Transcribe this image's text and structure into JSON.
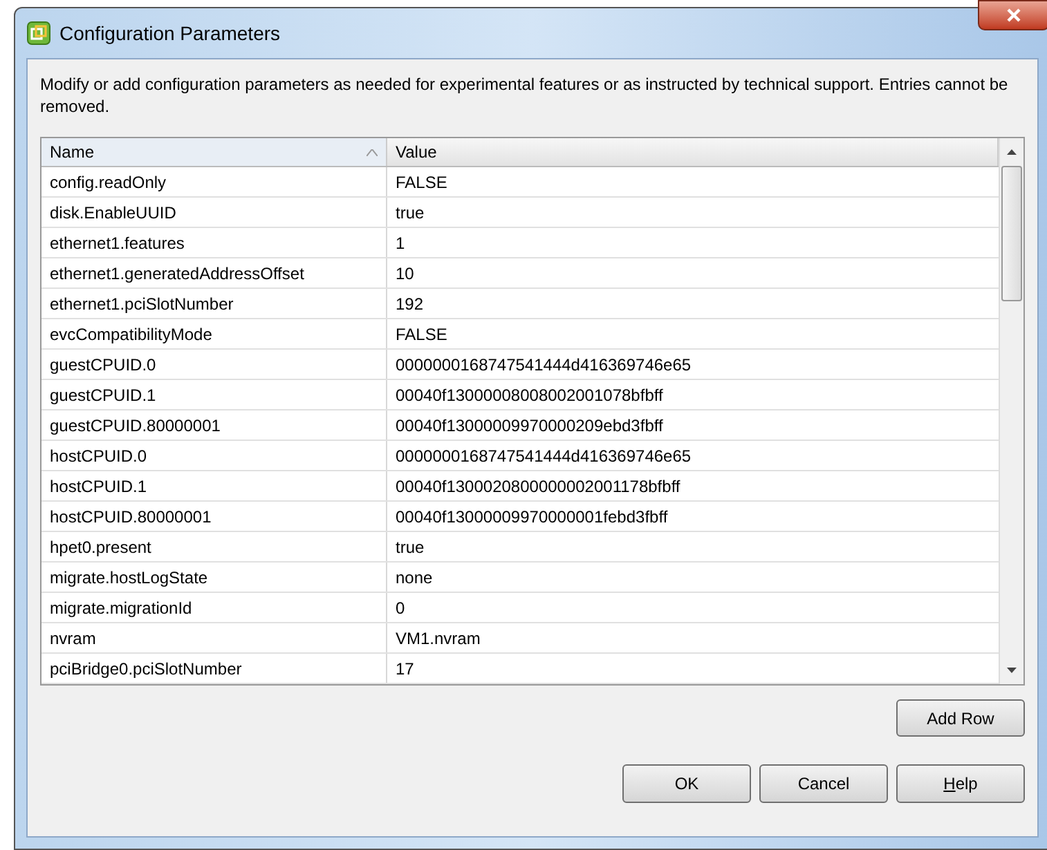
{
  "window": {
    "title": "Configuration Parameters"
  },
  "description": "Modify or add configuration parameters as needed for experimental features or as instructed by technical support. Entries cannot be removed.",
  "table": {
    "columns": [
      {
        "label": "Name",
        "sorted": true
      },
      {
        "label": "Value",
        "sorted": false
      }
    ],
    "rows": [
      [
        "config.readOnly",
        "FALSE"
      ],
      [
        "disk.EnableUUID",
        "true"
      ],
      [
        "ethernet1.features",
        "1"
      ],
      [
        "ethernet1.generatedAddressOffset",
        "10"
      ],
      [
        "ethernet1.pciSlotNumber",
        "192"
      ],
      [
        "evcCompatibilityMode",
        "FALSE"
      ],
      [
        "guestCPUID.0",
        "0000000168747541444d416369746e65"
      ],
      [
        "guestCPUID.1",
        "00040f13000008008002001078bfbff"
      ],
      [
        "guestCPUID.80000001",
        "00040f13000009970000209ebd3fbff"
      ],
      [
        "hostCPUID.0",
        "0000000168747541444d416369746e65"
      ],
      [
        "hostCPUID.1",
        "00040f1300020800000002001178bfbff"
      ],
      [
        "hostCPUID.80000001",
        "00040f13000009970000001febd3fbff"
      ],
      [
        "hpet0.present",
        "true"
      ],
      [
        "migrate.hostLogState",
        "none"
      ],
      [
        "migrate.migrationId",
        "0"
      ],
      [
        "nvram",
        "VM1.nvram"
      ],
      [
        "pciBridge0.pciSlotNumber",
        "17"
      ]
    ]
  },
  "add_button": "Add Row",
  "buttons": [
    {
      "label": "OK",
      "mnemonic": false
    },
    {
      "label": "Cancel",
      "mnemonic": false
    },
    {
      "label": "Help",
      "mnemonic": true
    }
  ]
}
